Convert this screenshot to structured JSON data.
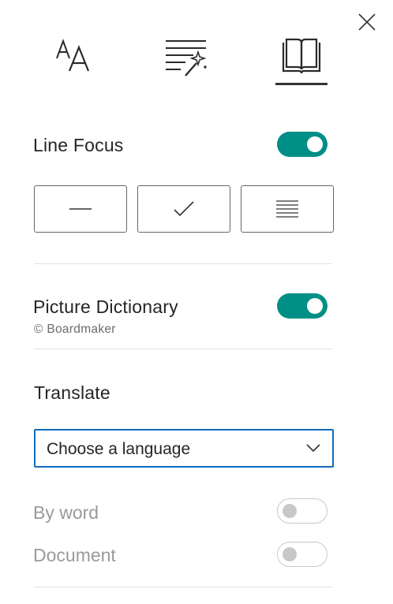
{
  "tabs": [
    {
      "icon": "text-size-icon",
      "selected": false
    },
    {
      "icon": "grammar-options-icon",
      "selected": false
    },
    {
      "icon": "book-icon",
      "selected": true
    }
  ],
  "line_focus": {
    "title": "Line Focus",
    "enabled": true,
    "options": [
      {
        "icon": "single-line-icon"
      },
      {
        "icon": "checkmark-icon"
      },
      {
        "icon": "multi-line-icon"
      }
    ]
  },
  "picture_dictionary": {
    "title": "Picture Dictionary",
    "credit": "© Boardmaker",
    "enabled": true
  },
  "translate": {
    "title": "Translate",
    "language_placeholder": "Choose a language",
    "by_word": {
      "label": "By word",
      "enabled": false
    },
    "document": {
      "label": "Document",
      "enabled": false
    }
  },
  "colors": {
    "accent_toggle": "#008f86",
    "dropdown_border": "#0f6cbd",
    "disabled_text": "#9a9a9a"
  }
}
